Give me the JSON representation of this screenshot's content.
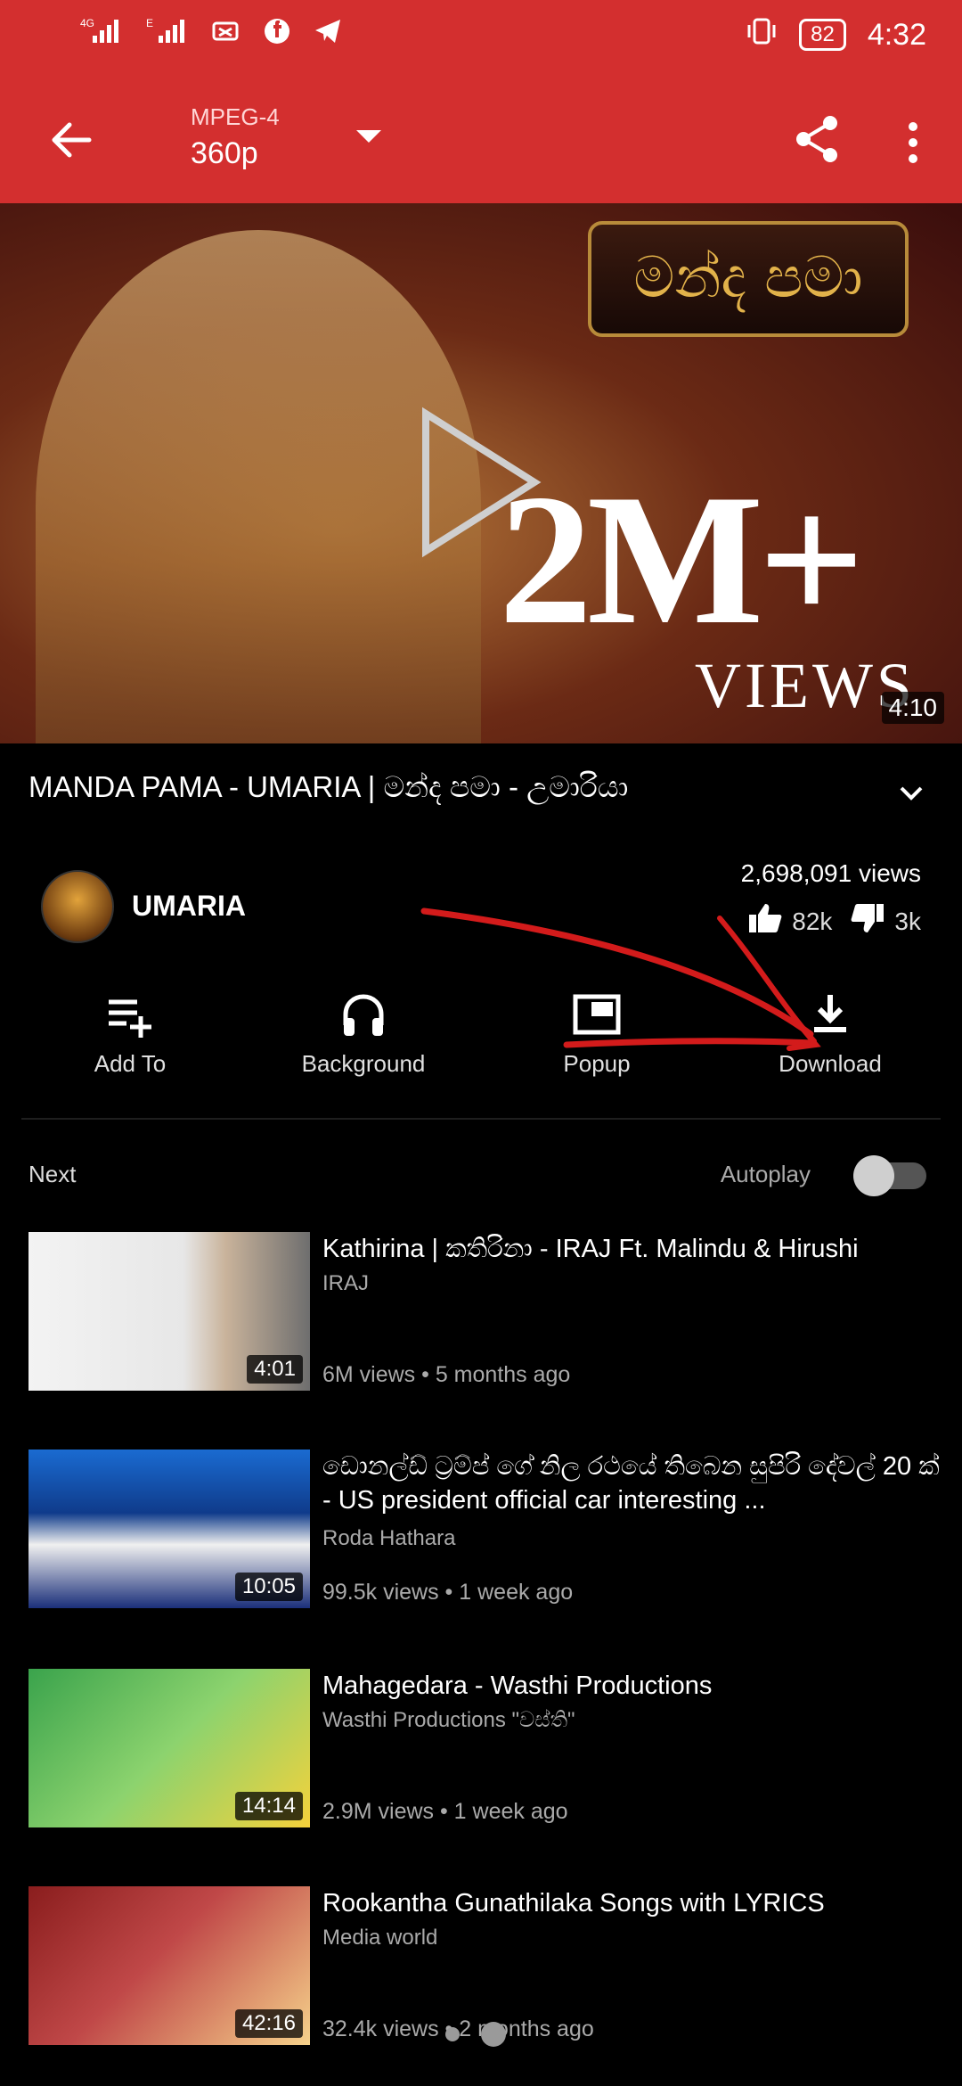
{
  "status": {
    "signal_labels": [
      "4G",
      "E"
    ],
    "battery": "82",
    "time": "4:32"
  },
  "toolbar": {
    "format_small": "MPEG-4",
    "format_big": "360p"
  },
  "video": {
    "overlay_big": "2M+",
    "overlay_views": "VIEWS",
    "duration": "4:10"
  },
  "title": "MANDA PAMA - UMARIA | මන්ද   පමා - උමාරියා",
  "channel": {
    "name": "UMARIA",
    "views": "2,698,091 views",
    "likes": "82k",
    "dislikes": "3k"
  },
  "actions": [
    {
      "label": "Add To"
    },
    {
      "label": "Background"
    },
    {
      "label": "Popup"
    },
    {
      "label": "Download"
    }
  ],
  "next_label": "Next",
  "autoplay_label": "Autoplay",
  "list": [
    {
      "title": "Kathirina | කතිරිනා - IRAJ Ft. Malindu & Hirushi",
      "channel": "IRAJ",
      "meta": "6M views • 5 months ago",
      "duration": "4:01"
    },
    {
      "title": "ඩොනල්ඩ් ට්‍රම්ප් ගේ නිල රථයේ තිබෙන සුපිරි දේවල් 20 ක් - US president official car interesting ...",
      "channel": "Roda Hathara",
      "meta": "99.5k views • 1 week ago",
      "duration": "10:05"
    },
    {
      "title": "Mahagedara - Wasthi Productions",
      "channel": "Wasthi Productions \"වස්ති\"",
      "meta": "2.9M views • 1 week ago",
      "duration": "14:14"
    },
    {
      "title": "Rookantha Gunathilaka Songs with LYRICS",
      "channel": "Media world",
      "meta": "32.4k views • 2 months ago",
      "duration": "42:16"
    }
  ]
}
